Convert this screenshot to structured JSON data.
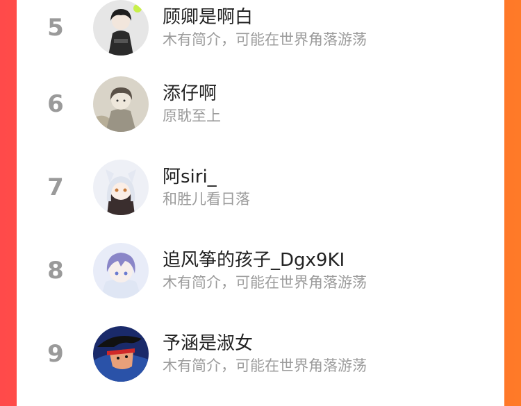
{
  "ranking": {
    "items": [
      {
        "rank": "5",
        "name": "顾卿是啊白",
        "bio": "木有简介，可能在世界角落游荡",
        "avatar": "dark-haired-boy-avatar"
      },
      {
        "rank": "6",
        "name": "添仔啊",
        "bio": "原耽至上",
        "avatar": "sketch-boy-avatar"
      },
      {
        "rank": "7",
        "name": "阿siri_",
        "bio": "和胜儿看日落",
        "avatar": "white-haired-anime-girl-avatar"
      },
      {
        "rank": "8",
        "name": "追风筝的孩子_Dgx9KI",
        "bio": "木有简介，可能在世界角落游荡",
        "avatar": "blue-haired-anime-boy-avatar"
      },
      {
        "rank": "9",
        "name": "予涵是淑女",
        "bio": "木有简介，可能在世界角落游荡",
        "avatar": "retro-anime-hero-avatar"
      }
    ]
  },
  "colors": {
    "background_gradient_start": "#ff4a4a",
    "background_gradient_end": "#ff7a28",
    "panel": "#ffffff",
    "rank_number": "#9a9a9a",
    "name_text": "#222222",
    "bio_text": "#9b9b9b"
  }
}
